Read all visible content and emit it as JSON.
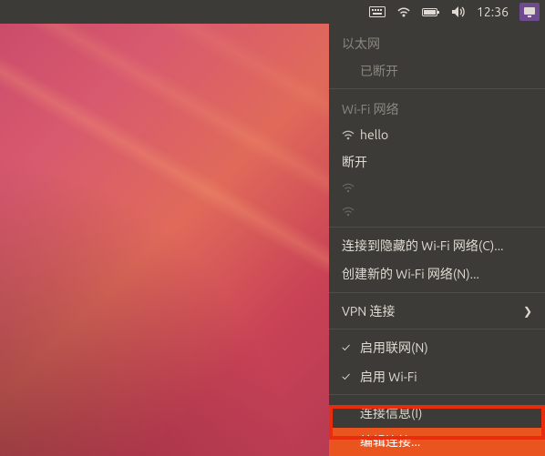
{
  "topbar": {
    "time": "12:36",
    "icons": {
      "keyboard": "keyboard-icon",
      "network": "network-icon",
      "battery": "battery-icon",
      "volume": "volume-icon",
      "session": "session-icon"
    }
  },
  "menu": {
    "ethernet_header": "以太网",
    "ethernet_disconnected": "已断开",
    "wifi_header": "Wi-Fi 网络",
    "wifi_ssid": "hello",
    "wifi_disconnect": "断开",
    "connect_hidden": "连接到隐藏的 Wi-Fi 网络(C)...",
    "create_new": "创建新的 Wi-Fi 网络(N)...",
    "vpn": "VPN 连接",
    "enable_networking": "启用联网(N)",
    "enable_wifi": "启用 Wi-Fi",
    "connection_info": "连接信息(I)",
    "edit_connections": "编辑连接..."
  }
}
